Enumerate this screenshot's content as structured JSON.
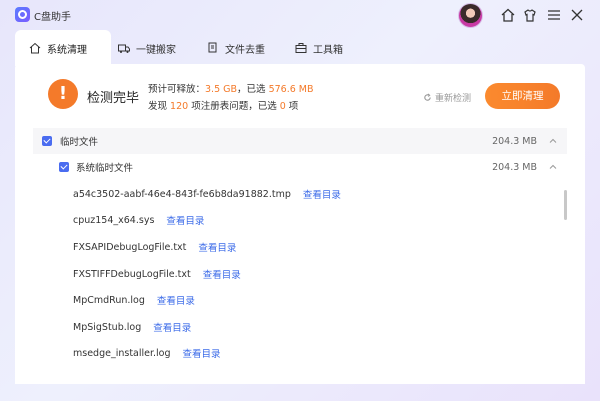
{
  "app": {
    "title": "C盘助手"
  },
  "tabs": [
    {
      "label": "系统清理",
      "icon": "home-clean-icon",
      "active": true
    },
    {
      "label": "一键搬家",
      "icon": "truck-icon",
      "active": false
    },
    {
      "label": "文件去重",
      "icon": "files-icon",
      "active": false
    },
    {
      "label": "工具箱",
      "icon": "toolbox-icon",
      "active": false
    }
  ],
  "scan": {
    "status": "检测完毕",
    "line1_prefix": "预计可释放：",
    "releasable": "3.5 GB",
    "line1_mid": "，已选 ",
    "selected_size": "576.6 MB",
    "line2_prefix": "发现 ",
    "issues": "120",
    "line2_mid": " 项注册表问题，已选 ",
    "issues_selected": "0",
    "line2_suffix": " 项",
    "rescan_label": "重新检测",
    "clean_label": "立即清理"
  },
  "list": {
    "group": {
      "label": "临时文件",
      "size": "204.3 MB",
      "checked": true
    },
    "subgroup": {
      "label": "系统临时文件",
      "size": "204.3 MB",
      "checked": true
    },
    "link_label": "查看目录",
    "files": [
      "a54c3502-aabf-46e4-843f-fe6b8da91882.tmp",
      "cpuz154_x64.sys",
      "FXSAPIDebugLogFile.txt",
      "FXSTIFFDebugLogFile.txt",
      "MpCmdRun.log",
      "MpSigStub.log",
      "msedge_installer.log"
    ]
  },
  "colors": {
    "accent": "#f47a2a",
    "link": "#3a6ae8",
    "checkbox": "#4a6cf0"
  }
}
